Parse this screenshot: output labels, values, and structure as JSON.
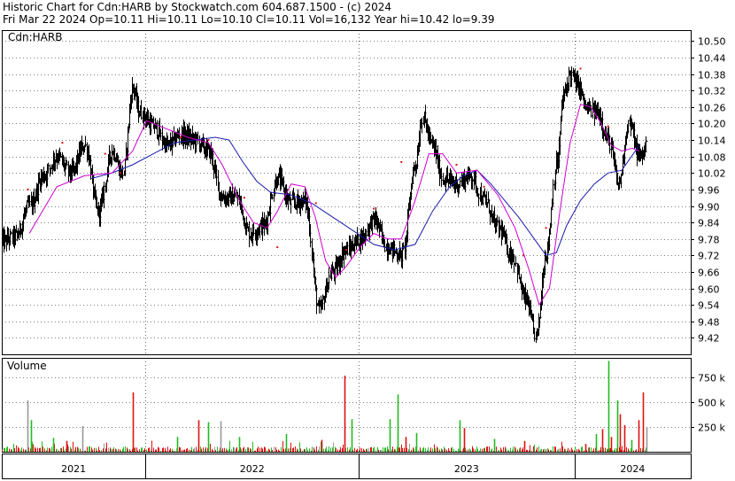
{
  "header": {
    "title": "Historic Chart for Cdn:HARB by Stockwatch.com 604.687.1500 - (c) 2024",
    "quote": "Fri Mar 22 2024   Op=10.11   Hi=10.11   Lo=10.10   Cl=10.11   Vol=16,132   Year hi=10.42   lo=9.39"
  },
  "colors": {
    "price_bar": "#000000",
    "ma_short": "#d000d0",
    "ma_long": "#1a1ab0",
    "vol_up": "#22bb22",
    "vol_down": "#dd1111",
    "vol_neutral": "#999999",
    "marker": "#dd1111",
    "grid": "#000000"
  },
  "chart_data": [
    {
      "type": "line",
      "panel": "price",
      "title": "Cdn:HARB",
      "ylim": [
        9.36,
        10.54
      ],
      "y_ticks": [
        "10.50",
        "10.44",
        "10.38",
        "10.32",
        "10.26",
        "10.20",
        "10.14",
        "10.08",
        "10.02",
        "9.96",
        "9.90",
        "9.84",
        "9.78",
        "9.72",
        "9.66",
        "9.60",
        "9.54",
        "9.48",
        "9.42"
      ],
      "x_labels": [
        "2021",
        "2022",
        "2023",
        "2024"
      ],
      "x_dividers": [
        0.2087,
        0.5181,
        0.8313
      ],
      "grid": true,
      "close_series": [
        {
          "t": 0.0,
          "v": 9.77
        },
        {
          "t": 0.02,
          "v": 9.79
        },
        {
          "t": 0.04,
          "v": 9.9
        },
        {
          "t": 0.06,
          "v": 10.01
        },
        {
          "t": 0.08,
          "v": 10.08
        },
        {
          "t": 0.1,
          "v": 10.02
        },
        {
          "t": 0.12,
          "v": 10.12
        },
        {
          "t": 0.14,
          "v": 9.88
        },
        {
          "t": 0.16,
          "v": 10.1
        },
        {
          "t": 0.175,
          "v": 10.02
        },
        {
          "t": 0.19,
          "v": 10.33
        },
        {
          "t": 0.2,
          "v": 10.24
        },
        {
          "t": 0.22,
          "v": 10.19
        },
        {
          "t": 0.24,
          "v": 10.12
        },
        {
          "t": 0.26,
          "v": 10.16
        },
        {
          "t": 0.28,
          "v": 10.14
        },
        {
          "t": 0.3,
          "v": 10.1
        },
        {
          "t": 0.32,
          "v": 9.93
        },
        {
          "t": 0.34,
          "v": 9.93
        },
        {
          "t": 0.36,
          "v": 9.8
        },
        {
          "t": 0.38,
          "v": 9.83
        },
        {
          "t": 0.4,
          "v": 10.0
        },
        {
          "t": 0.42,
          "v": 9.91
        },
        {
          "t": 0.44,
          "v": 9.92
        },
        {
          "t": 0.46,
          "v": 9.52
        },
        {
          "t": 0.48,
          "v": 9.66
        },
        {
          "t": 0.5,
          "v": 9.74
        },
        {
          "t": 0.52,
          "v": 9.78
        },
        {
          "t": 0.54,
          "v": 9.85
        },
        {
          "t": 0.56,
          "v": 9.75
        },
        {
          "t": 0.58,
          "v": 9.72
        },
        {
          "t": 0.6,
          "v": 10.05
        },
        {
          "t": 0.61,
          "v": 10.22
        },
        {
          "t": 0.625,
          "v": 10.12
        },
        {
          "t": 0.64,
          "v": 10.0
        },
        {
          "t": 0.66,
          "v": 9.98
        },
        {
          "t": 0.68,
          "v": 10.01
        },
        {
          "t": 0.7,
          "v": 9.92
        },
        {
          "t": 0.72,
          "v": 9.82
        },
        {
          "t": 0.74,
          "v": 9.72
        },
        {
          "t": 0.76,
          "v": 9.56
        },
        {
          "t": 0.775,
          "v": 9.43
        },
        {
          "t": 0.79,
          "v": 9.73
        },
        {
          "t": 0.805,
          "v": 10.05
        },
        {
          "t": 0.815,
          "v": 10.3
        },
        {
          "t": 0.825,
          "v": 10.38
        },
        {
          "t": 0.835,
          "v": 10.34
        },
        {
          "t": 0.85,
          "v": 10.25
        },
        {
          "t": 0.865,
          "v": 10.24
        },
        {
          "t": 0.88,
          "v": 10.14
        },
        {
          "t": 0.895,
          "v": 9.98
        },
        {
          "t": 0.91,
          "v": 10.2
        },
        {
          "t": 0.925,
          "v": 10.08
        },
        {
          "t": 0.935,
          "v": 10.11
        }
      ],
      "ma_short_series": [
        {
          "t": 0.04,
          "v": 9.8
        },
        {
          "t": 0.08,
          "v": 9.97
        },
        {
          "t": 0.12,
          "v": 10.01
        },
        {
          "t": 0.16,
          "v": 10.02
        },
        {
          "t": 0.19,
          "v": 10.1
        },
        {
          "t": 0.21,
          "v": 10.21
        },
        {
          "t": 0.24,
          "v": 10.18
        },
        {
          "t": 0.27,
          "v": 10.15
        },
        {
          "t": 0.3,
          "v": 10.13
        },
        {
          "t": 0.32,
          "v": 10.05
        },
        {
          "t": 0.345,
          "v": 9.92
        },
        {
          "t": 0.365,
          "v": 9.84
        },
        {
          "t": 0.385,
          "v": 9.82
        },
        {
          "t": 0.4,
          "v": 9.88
        },
        {
          "t": 0.42,
          "v": 9.98
        },
        {
          "t": 0.44,
          "v": 9.97
        },
        {
          "t": 0.455,
          "v": 9.86
        },
        {
          "t": 0.47,
          "v": 9.7
        },
        {
          "t": 0.485,
          "v": 9.64
        },
        {
          "t": 0.5,
          "v": 9.68
        },
        {
          "t": 0.52,
          "v": 9.75
        },
        {
          "t": 0.54,
          "v": 9.8
        },
        {
          "t": 0.56,
          "v": 9.78
        },
        {
          "t": 0.58,
          "v": 9.78
        },
        {
          "t": 0.6,
          "v": 9.92
        },
        {
          "t": 0.62,
          "v": 10.09
        },
        {
          "t": 0.64,
          "v": 10.09
        },
        {
          "t": 0.66,
          "v": 10.02
        },
        {
          "t": 0.69,
          "v": 10.03
        },
        {
          "t": 0.72,
          "v": 9.94
        },
        {
          "t": 0.745,
          "v": 9.82
        },
        {
          "t": 0.765,
          "v": 9.67
        },
        {
          "t": 0.78,
          "v": 9.54
        },
        {
          "t": 0.795,
          "v": 9.6
        },
        {
          "t": 0.81,
          "v": 9.88
        },
        {
          "t": 0.825,
          "v": 10.13
        },
        {
          "t": 0.84,
          "v": 10.27
        },
        {
          "t": 0.855,
          "v": 10.26
        },
        {
          "t": 0.87,
          "v": 10.2
        },
        {
          "t": 0.885,
          "v": 10.12
        },
        {
          "t": 0.9,
          "v": 10.1
        },
        {
          "t": 0.915,
          "v": 10.11
        },
        {
          "t": 0.925,
          "v": 10.1
        }
      ],
      "ma_long_series": [
        {
          "t": 0.13,
          "v": 10.0
        },
        {
          "t": 0.16,
          "v": 10.02
        },
        {
          "t": 0.19,
          "v": 10.05
        },
        {
          "t": 0.22,
          "v": 10.09
        },
        {
          "t": 0.25,
          "v": 10.13
        },
        {
          "t": 0.28,
          "v": 10.14
        },
        {
          "t": 0.31,
          "v": 10.15
        },
        {
          "t": 0.33,
          "v": 10.14
        },
        {
          "t": 0.35,
          "v": 10.06
        },
        {
          "t": 0.37,
          "v": 9.99
        },
        {
          "t": 0.39,
          "v": 9.95
        },
        {
          "t": 0.42,
          "v": 9.94
        },
        {
          "t": 0.45,
          "v": 9.91
        },
        {
          "t": 0.48,
          "v": 9.86
        },
        {
          "t": 0.51,
          "v": 9.81
        },
        {
          "t": 0.54,
          "v": 9.76
        },
        {
          "t": 0.57,
          "v": 9.74
        },
        {
          "t": 0.6,
          "v": 9.76
        },
        {
          "t": 0.625,
          "v": 9.88
        },
        {
          "t": 0.65,
          "v": 9.97
        },
        {
          "t": 0.67,
          "v": 10.01
        },
        {
          "t": 0.69,
          "v": 10.03
        },
        {
          "t": 0.71,
          "v": 9.98
        },
        {
          "t": 0.73,
          "v": 9.92
        },
        {
          "t": 0.75,
          "v": 9.86
        },
        {
          "t": 0.77,
          "v": 9.79
        },
        {
          "t": 0.79,
          "v": 9.72
        },
        {
          "t": 0.805,
          "v": 9.73
        },
        {
          "t": 0.82,
          "v": 9.83
        },
        {
          "t": 0.84,
          "v": 9.92
        },
        {
          "t": 0.86,
          "v": 9.98
        },
        {
          "t": 0.88,
          "v": 10.02
        },
        {
          "t": 0.9,
          "v": 10.03
        },
        {
          "t": 0.925,
          "v": 10.12
        }
      ],
      "red_dots": [
        {
          "t": 0.038,
          "v": 9.96
        },
        {
          "t": 0.088,
          "v": 10.13
        },
        {
          "t": 0.15,
          "v": 10.09
        },
        {
          "t": 0.172,
          "v": 10.02
        },
        {
          "t": 0.26,
          "v": 10.15
        },
        {
          "t": 0.3,
          "v": 10.14
        },
        {
          "t": 0.352,
          "v": 9.93
        },
        {
          "t": 0.4,
          "v": 9.75
        },
        {
          "t": 0.456,
          "v": 9.91
        },
        {
          "t": 0.5,
          "v": 9.74
        },
        {
          "t": 0.54,
          "v": 9.89
        },
        {
          "t": 0.58,
          "v": 10.06
        },
        {
          "t": 0.66,
          "v": 10.05
        },
        {
          "t": 0.7,
          "v": 9.97
        },
        {
          "t": 0.757,
          "v": 9.72
        },
        {
          "t": 0.79,
          "v": 9.82
        },
        {
          "t": 0.84,
          "v": 10.4
        },
        {
          "t": 0.88,
          "v": 10.19
        }
      ]
    },
    {
      "type": "bar",
      "panel": "volume",
      "title": "Volume",
      "ylim": [
        0,
        950
      ],
      "y_ticks": [
        "750 k",
        "500 k",
        "250 k"
      ],
      "y_tick_values": [
        750,
        500,
        250
      ],
      "spikes": [
        {
          "t": 0.037,
          "v": 520,
          "color": "neutral"
        },
        {
          "t": 0.043,
          "v": 320,
          "color": "up"
        },
        {
          "t": 0.075,
          "v": 140,
          "color": "up"
        },
        {
          "t": 0.094,
          "v": 110,
          "color": "down"
        },
        {
          "t": 0.117,
          "v": 260,
          "color": "neutral"
        },
        {
          "t": 0.19,
          "v": 600,
          "color": "down"
        },
        {
          "t": 0.255,
          "v": 150,
          "color": "up"
        },
        {
          "t": 0.285,
          "v": 320,
          "color": "down"
        },
        {
          "t": 0.3,
          "v": 300,
          "color": "up"
        },
        {
          "t": 0.318,
          "v": 310,
          "color": "neutral"
        },
        {
          "t": 0.344,
          "v": 150,
          "color": "up"
        },
        {
          "t": 0.412,
          "v": 180,
          "color": "up"
        },
        {
          "t": 0.464,
          "v": 120,
          "color": "down"
        },
        {
          "t": 0.497,
          "v": 770,
          "color": "down"
        },
        {
          "t": 0.508,
          "v": 330,
          "color": "up"
        },
        {
          "t": 0.563,
          "v": 330,
          "color": "up"
        },
        {
          "t": 0.575,
          "v": 580,
          "color": "up"
        },
        {
          "t": 0.586,
          "v": 150,
          "color": "down"
        },
        {
          "t": 0.602,
          "v": 190,
          "color": "up"
        },
        {
          "t": 0.665,
          "v": 320,
          "color": "up"
        },
        {
          "t": 0.671,
          "v": 240,
          "color": "down"
        },
        {
          "t": 0.715,
          "v": 130,
          "color": "up"
        },
        {
          "t": 0.758,
          "v": 110,
          "color": "down"
        },
        {
          "t": 0.847,
          "v": 80,
          "color": "down"
        },
        {
          "t": 0.863,
          "v": 180,
          "color": "up"
        },
        {
          "t": 0.872,
          "v": 230,
          "color": "down"
        },
        {
          "t": 0.88,
          "v": 920,
          "color": "up"
        },
        {
          "t": 0.884,
          "v": 150,
          "color": "down"
        },
        {
          "t": 0.893,
          "v": 520,
          "color": "up"
        },
        {
          "t": 0.897,
          "v": 380,
          "color": "down"
        },
        {
          "t": 0.903,
          "v": 270,
          "color": "down"
        },
        {
          "t": 0.914,
          "v": 120,
          "color": "up"
        },
        {
          "t": 0.924,
          "v": 320,
          "color": "down"
        },
        {
          "t": 0.93,
          "v": 600,
          "color": "down"
        },
        {
          "t": 0.936,
          "v": 250,
          "color": "neutral"
        }
      ]
    }
  ]
}
